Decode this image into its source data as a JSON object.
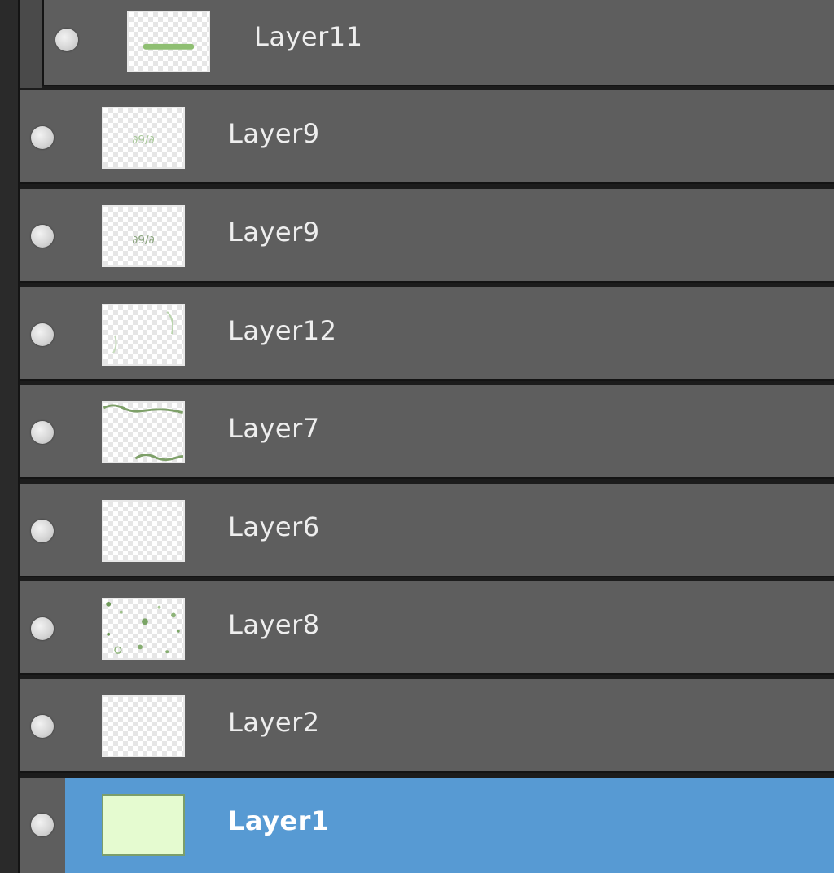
{
  "panel": {
    "title": "",
    "accent_color": "#579ad3",
    "row_color": "#5e5e5e"
  },
  "layers": [
    {
      "name": "Layer11",
      "visible": true,
      "clipped": true,
      "selected": false,
      "thumbnail": "green-line-thumbnail"
    },
    {
      "name": "Layer9",
      "visible": true,
      "clipped": false,
      "selected": false,
      "thumbnail": "text-thumbnail"
    },
    {
      "name": "Layer9",
      "visible": true,
      "clipped": false,
      "selected": false,
      "thumbnail": "text-thumbnail"
    },
    {
      "name": "Layer12",
      "visible": true,
      "clipped": false,
      "selected": false,
      "thumbnail": "corner-marks-thumbnail"
    },
    {
      "name": "Layer7",
      "visible": true,
      "clipped": false,
      "selected": false,
      "thumbnail": "wave-border-thumbnail"
    },
    {
      "name": "Layer6",
      "visible": true,
      "clipped": false,
      "selected": false,
      "thumbnail": "transparent-thumbnail"
    },
    {
      "name": "Layer8",
      "visible": true,
      "clipped": false,
      "selected": false,
      "thumbnail": "dots-thumbnail"
    },
    {
      "name": "Layer2",
      "visible": true,
      "clipped": false,
      "selected": false,
      "thumbnail": "transparent-thumbnail"
    },
    {
      "name": "Layer1",
      "visible": true,
      "clipped": false,
      "selected": true,
      "thumbnail": "solid-green-thumbnail"
    }
  ]
}
